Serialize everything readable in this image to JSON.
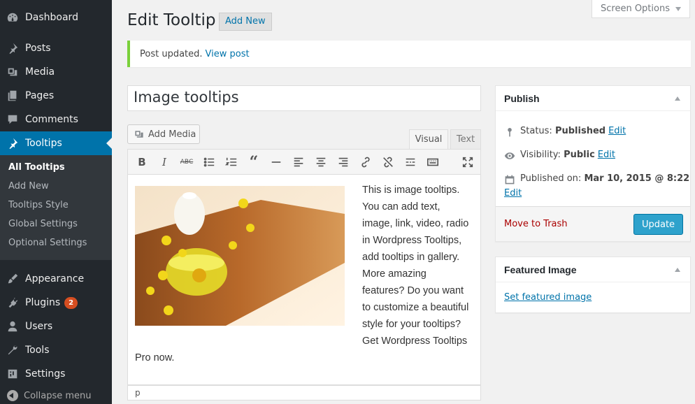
{
  "sidebar": {
    "items": [
      {
        "label": "Dashboard",
        "icon": "dashboard-icon"
      },
      {
        "label": "Posts",
        "icon": "pin-icon"
      },
      {
        "label": "Media",
        "icon": "media-icon"
      },
      {
        "label": "Pages",
        "icon": "pages-icon"
      },
      {
        "label": "Comments",
        "icon": "comment-icon"
      },
      {
        "label": "Tooltips",
        "icon": "pin-icon"
      },
      {
        "label": "Appearance",
        "icon": "brush-icon"
      },
      {
        "label": "Plugins",
        "icon": "plugin-icon",
        "badge": "2"
      },
      {
        "label": "Users",
        "icon": "user-icon"
      },
      {
        "label": "Tools",
        "icon": "wrench-icon"
      },
      {
        "label": "Settings",
        "icon": "settings-icon"
      }
    ],
    "submenu": [
      "All Tooltips",
      "Add New",
      "Tooltips Style",
      "Global Settings",
      "Optional Settings"
    ],
    "collapse_label": "Collapse menu"
  },
  "header": {
    "screen_options": "Screen Options",
    "title": "Edit Tooltip",
    "add_new": "Add New"
  },
  "notice": {
    "text": "Post updated.",
    "link": "View post"
  },
  "editor": {
    "post_title": "Image tooltips",
    "add_media": "Add Media",
    "tab_visual": "Visual",
    "tab_text": "Text",
    "body": "This is image tooltips. You can add text, image, link, video, radio in Wordpress Tooltips, add tooltips in gallery. More amazing features? Do you want to customize a beautiful style for your tooltips? Get Wordpress Tooltips Pro now.",
    "path": "p"
  },
  "publish": {
    "heading": "Publish",
    "status_label": "Status:",
    "status_value": "Published",
    "visibility_label": "Visibility:",
    "visibility_value": "Public",
    "published_label": "Published on:",
    "published_value": "Mar 10, 2015 @ 8:22",
    "edit": "Edit",
    "trash": "Move to Trash",
    "update": "Update"
  },
  "featured": {
    "heading": "Featured Image",
    "link": "Set featured image"
  },
  "colors": {
    "accent": "#0073aa",
    "sidebar_bg": "#23282d",
    "notice_border": "#7ad03a",
    "update_button": "#2ea2cc"
  }
}
